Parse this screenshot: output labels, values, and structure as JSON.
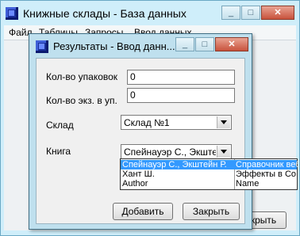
{
  "main_window": {
    "title": "Книжные склады - База данных",
    "menu": [
      "Файл",
      "Таблицы",
      "Запросы",
      "Ввод данных"
    ],
    "hidden_button_label": "Закрыть"
  },
  "dialog": {
    "title": "Результаты - Ввод данн...",
    "fields": {
      "packages_label": "Кол-во упаковок",
      "packages_value": "0",
      "copies_label": "Кол-во экз. в уп.",
      "copies_value": "0",
      "warehouse_label": "Склад",
      "warehouse_value": "Склад №1",
      "book_label": "Книга",
      "book_value": "Спейнауэр С., Экштейн Р."
    },
    "book_options": [
      {
        "author": "Спейнауэр С., Экштейн Р.",
        "title": "Справочник веб",
        "selected": true
      },
      {
        "author": "Хант Ш.",
        "title": "Эффекты в Co"
      },
      {
        "author": "Author",
        "title": "Name"
      }
    ],
    "buttons": {
      "add": "Добавить",
      "close": "Закрыть"
    }
  },
  "colors": {
    "title_bg": "#cfeefa",
    "dialog_bg": "#bfe0ee",
    "selection": "#3399ff",
    "close_button": "#c8523c"
  }
}
